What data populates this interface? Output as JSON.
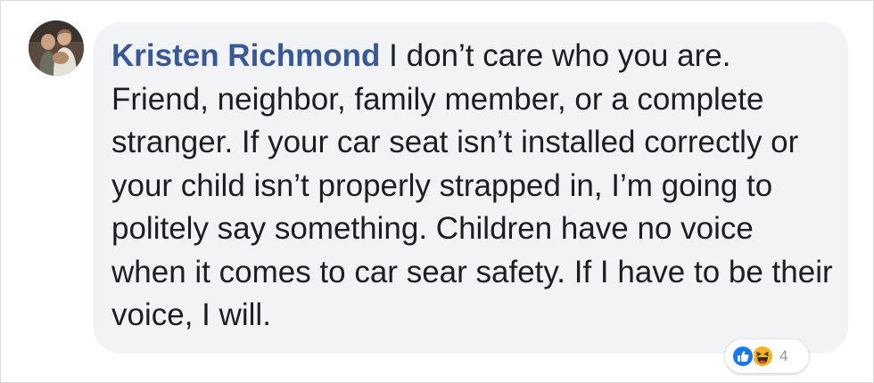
{
  "comment": {
    "author": "Kristen Richmond",
    "text": "I don’t care who you are. Friend, neighbor, family member, or a complete stranger. If your car seat isn’t installed correctly or your child isn’t properly strapped in, I’m going to politely say something. Children have no voice when it comes to car sear safety. If I have to be their voice, I will.",
    "reactions": {
      "icons": [
        "like-icon",
        "haha-icon"
      ],
      "count": "4"
    }
  },
  "colors": {
    "author_link": "#385898",
    "bubble_bg": "#f2f3f5",
    "text": "#1c1e21",
    "like_blue": "#1877f2",
    "haha_yellow": "#f7b125"
  }
}
